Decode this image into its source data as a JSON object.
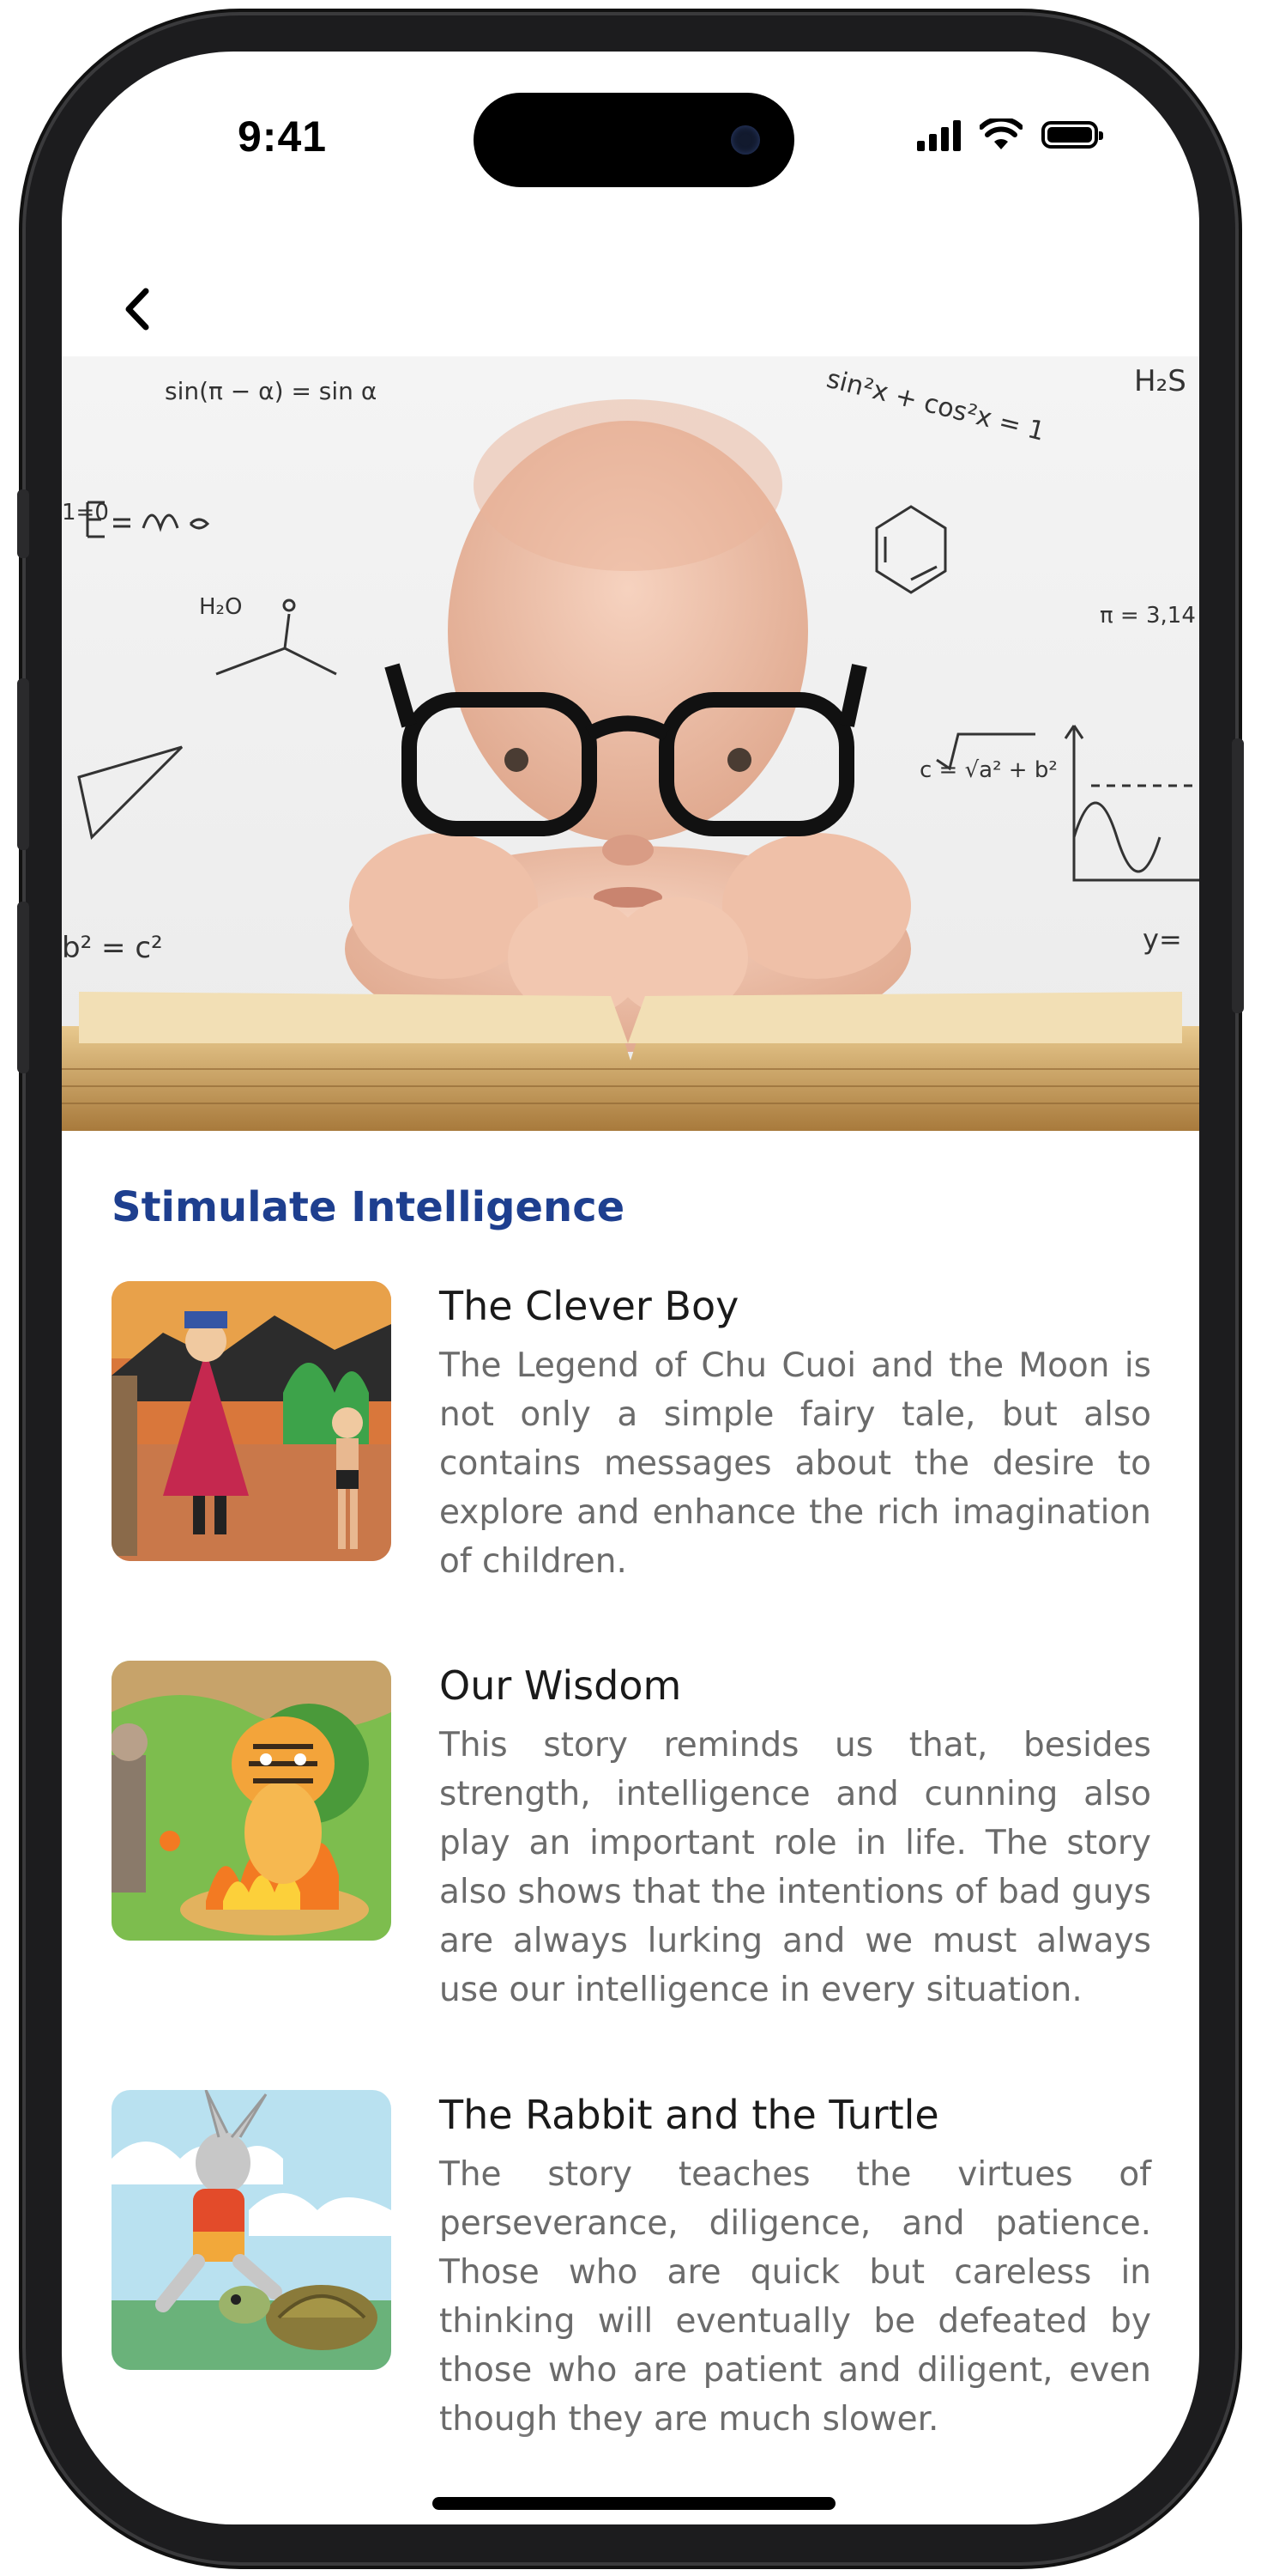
{
  "status": {
    "time": "9:41"
  },
  "nav": {
    "back_icon": "chevron-left-icon"
  },
  "hero": {
    "alt": "baby-with-glasses-and-book-photo"
  },
  "section": {
    "title": "Stimulate Intelligence",
    "stories": [
      {
        "title": "The Clever Boy",
        "description": "The Legend of Chu Cuoi and the Moon is not only a simple fairy tale, but also contains messages about the desire to explore and enhance the rich imagination of children."
      },
      {
        "title": "Our Wisdom",
        "description": "This story reminds us that, besides strength, intelligence and cunning also play an important role in life. The story also shows that the intentions of bad guys are always lurking and we must always use our intelligence in every situation."
      },
      {
        "title": "The Rabbit and the Turtle",
        "description": "The story teaches the virtues of perseverance, diligence, and patience. Those who are quick but careless in thinking will eventually be defeated by those who are patient and diligent, even though they are much slower."
      }
    ]
  },
  "colors": {
    "accent": "#1e3f8f",
    "body_text": "#6b6b6b",
    "title_text": "#1a1a1a"
  }
}
